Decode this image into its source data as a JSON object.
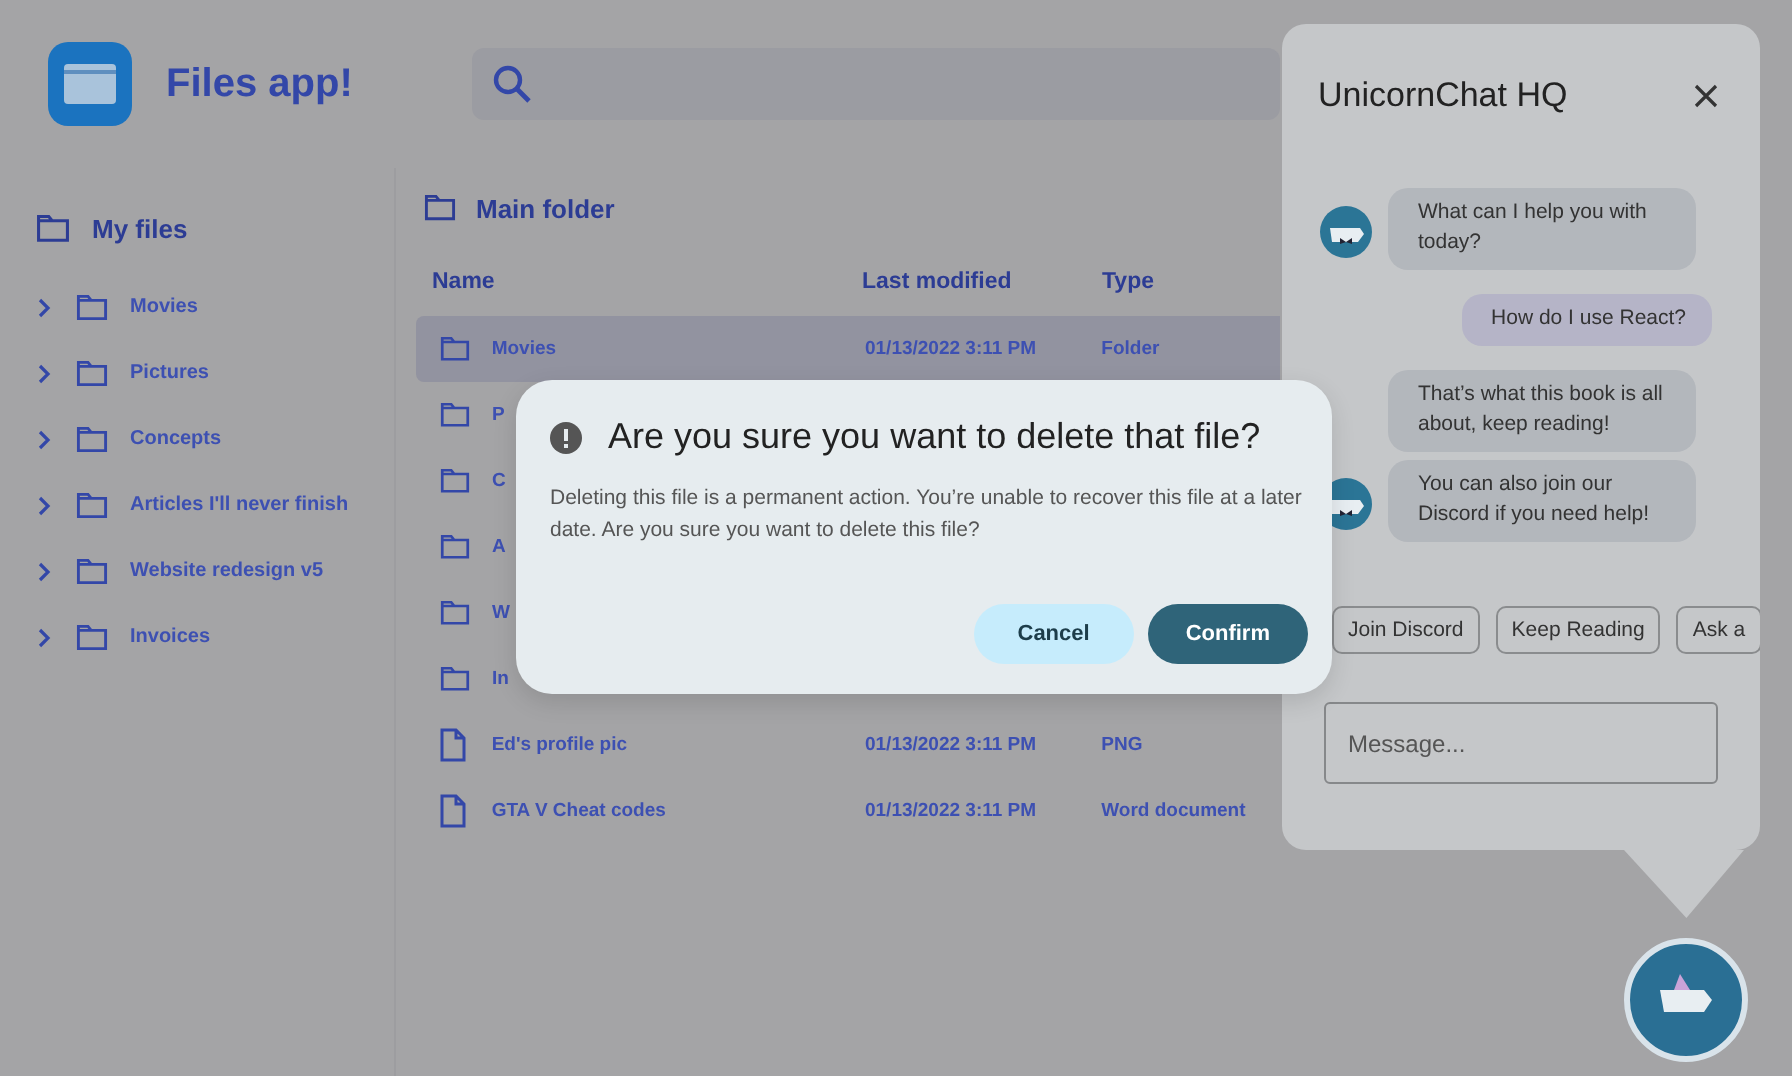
{
  "app": {
    "title": "Files app!"
  },
  "sidebar": {
    "root": "My files",
    "items": [
      {
        "label": "Movies",
        "expanded": false
      },
      {
        "label": "Pictures",
        "expanded": false
      },
      {
        "label": "Concepts",
        "expanded": false
      },
      {
        "label": "Articles I'll never finish",
        "expanded": false
      },
      {
        "label": "Website redesign v5",
        "expanded": false
      },
      {
        "label": "Invoices",
        "expanded": false
      }
    ]
  },
  "main": {
    "folder": "Main folder",
    "columns": [
      "Name",
      "Last modified",
      "Type"
    ],
    "rows": [
      {
        "kind": "folder",
        "name": "Movies",
        "modified": "01/13/2022 3:11 PM",
        "type": "Folder",
        "selected": true
      },
      {
        "kind": "folder",
        "name": "P",
        "selected": false
      },
      {
        "kind": "folder",
        "name": "C",
        "selected": false
      },
      {
        "kind": "folder",
        "name": "A",
        "selected": false
      },
      {
        "kind": "folder",
        "name": "W",
        "selected": false
      },
      {
        "kind": "folder",
        "name": "In",
        "selected": false
      },
      {
        "kind": "file",
        "name": "Ed's profile pic",
        "modified": "01/13/2022 3:11 PM",
        "type": "PNG",
        "selected": false
      },
      {
        "kind": "file",
        "name": "GTA V Cheat codes",
        "modified": "01/13/2022 3:11 PM",
        "type": "Word document",
        "selected": false
      }
    ]
  },
  "dialog": {
    "title": "Are you sure you want to delete that file?",
    "body": "Deleting this file is a permanent action. You’re unable to recover this file at a later date. Are you sure you want to delete this file?",
    "buttons": [
      {
        "label": "Cancel",
        "kind": "secondary"
      },
      {
        "label": "Confirm",
        "kind": "primary"
      }
    ]
  },
  "chat": {
    "title": "UnicornChat HQ",
    "messages": [
      {
        "kind": "bot",
        "text": "What can I help you with today?",
        "avatar": true
      },
      {
        "kind": "user",
        "text": "How do I use React?",
        "avatar": false
      },
      {
        "kind": "bot",
        "text": "That’s what this book is all about, keep reading!",
        "avatar": false
      },
      {
        "kind": "bot",
        "text": "You can also join our Discord if you need help!",
        "avatar": true
      }
    ],
    "suggestions": [
      "Join Discord",
      "Keep Reading",
      "Ask a"
    ],
    "input": {
      "placeholder": "Message..."
    }
  }
}
